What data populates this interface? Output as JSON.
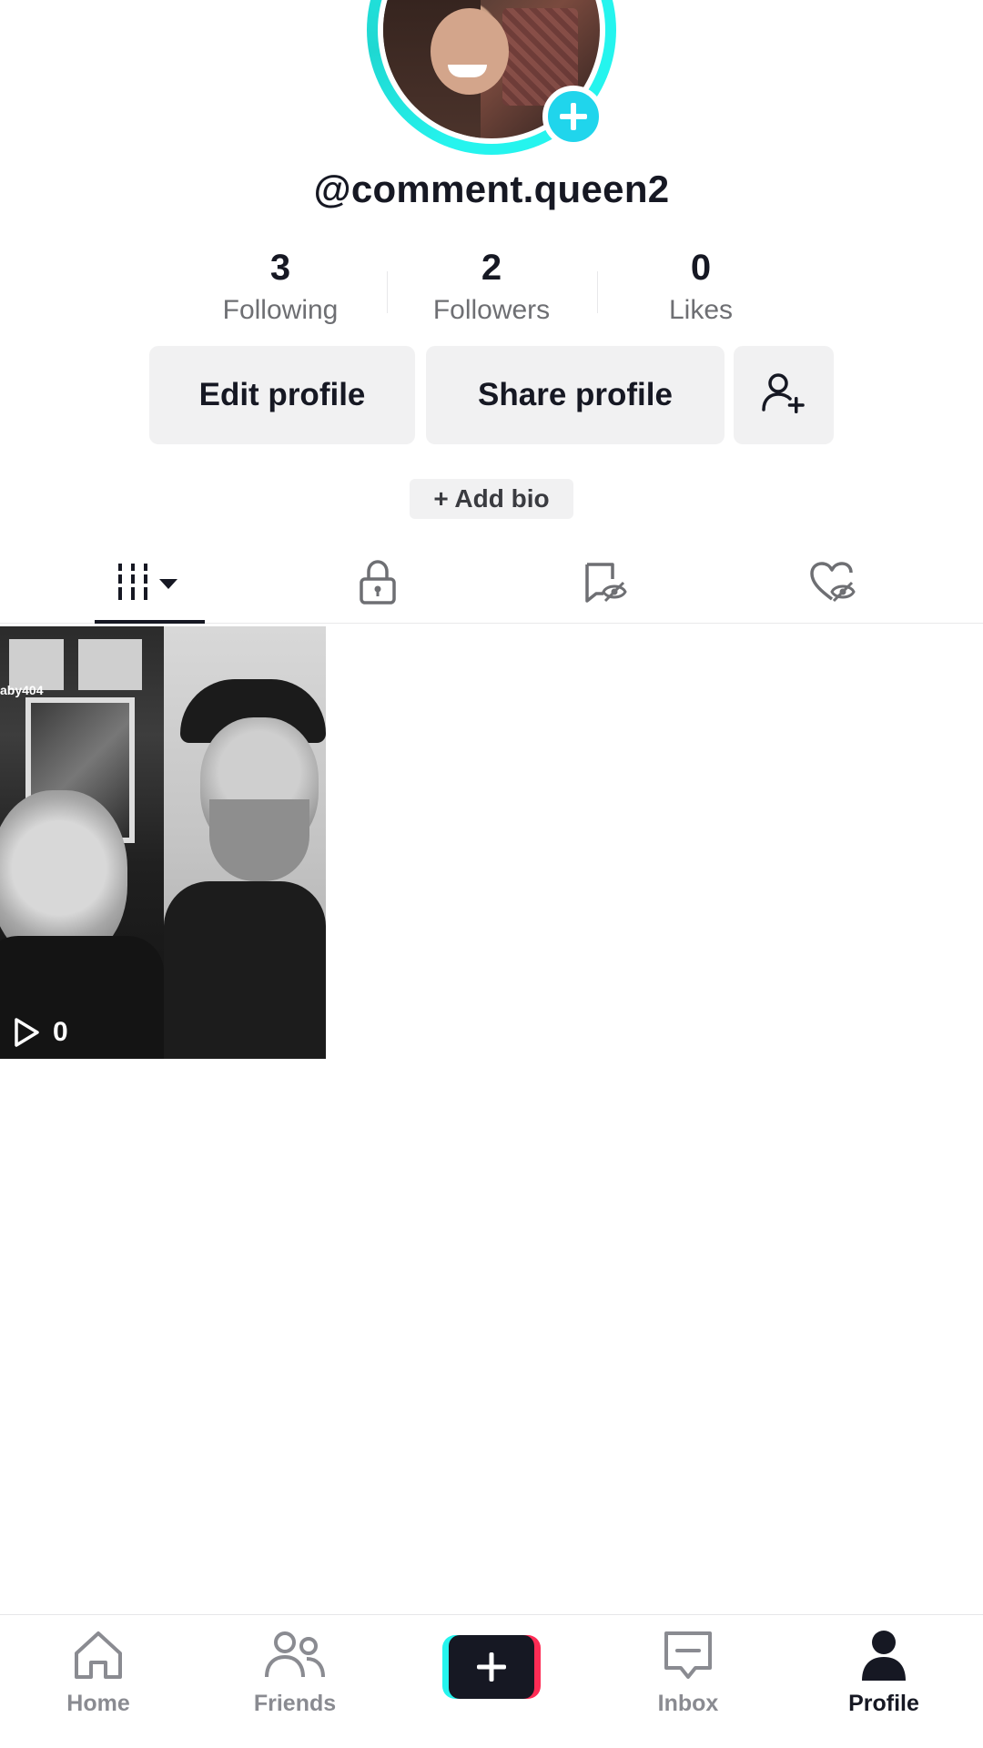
{
  "profile": {
    "username": "@comment.queen2",
    "stats": [
      {
        "value": "3",
        "label": "Following"
      },
      {
        "value": "2",
        "label": "Followers"
      },
      {
        "value": "0",
        "label": "Likes"
      }
    ]
  },
  "actions": {
    "edit_profile": "Edit profile",
    "share_profile": "Share profile",
    "add_bio": "+ Add bio"
  },
  "tabs": [
    {
      "name": "videos",
      "icon": "grid-icon",
      "active": true
    },
    {
      "name": "private",
      "icon": "lock-icon",
      "active": false
    },
    {
      "name": "reposts",
      "icon": "hidden-repost-icon",
      "active": false
    },
    {
      "name": "liked",
      "icon": "hidden-heart-icon",
      "active": false
    }
  ],
  "videos": [
    {
      "views": "0",
      "watermark": "aby404"
    }
  ],
  "bottom_nav": {
    "home": "Home",
    "friends": "Friends",
    "inbox": "Inbox",
    "profile": "Profile"
  },
  "colors": {
    "accent_cyan": "#25f4ee",
    "accent_pink": "#fe2c55",
    "add_badge": "#20d5ec",
    "text_primary": "#161823",
    "text_secondary": "#6e6f73"
  }
}
